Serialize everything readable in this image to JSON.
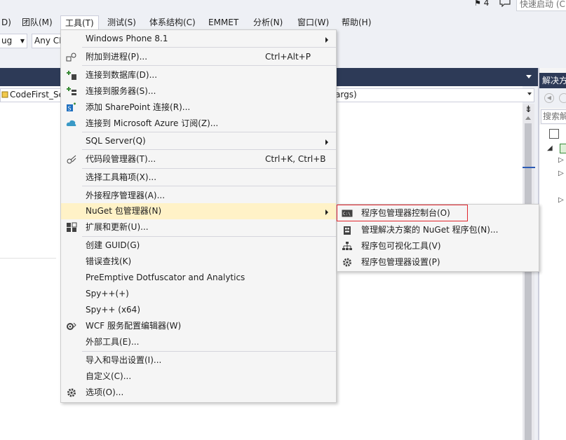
{
  "top": {
    "notif_count": "4",
    "quick_launch_placeholder": "快速启动 (C"
  },
  "menubar": {
    "items": [
      "D)",
      "团队(M)",
      "工具(T)",
      "测试(S)",
      "体系结构(C)",
      "EMMET",
      "分析(N)",
      "窗口(W)",
      "帮助(H)"
    ]
  },
  "toolbar": {
    "config_value": "ug",
    "platform_value": "Any CF"
  },
  "editor": {
    "nav_left": "CodeFirst_Se",
    "nav_right": "args)"
  },
  "solution_explorer": {
    "title": "解决方",
    "search_placeholder": "搜索解"
  },
  "tools_menu": {
    "items": [
      {
        "label": "Windows Phone 8.1",
        "shortcut": "",
        "submenu": true,
        "icon": ""
      },
      {
        "label": "附加到进程(P)...",
        "shortcut": "Ctrl+Alt+P",
        "submenu": false,
        "icon": "attach-process-icon"
      },
      {
        "label": "连接到数据库(D)...",
        "shortcut": "",
        "submenu": false,
        "icon": "connect-database-icon"
      },
      {
        "label": "连接到服务器(S)...",
        "shortcut": "",
        "submenu": false,
        "icon": "connect-server-icon"
      },
      {
        "label": "添加 SharePoint 连接(R)...",
        "shortcut": "",
        "submenu": false,
        "icon": "sharepoint-icon"
      },
      {
        "label": "连接到 Microsoft Azure 订阅(Z)...",
        "shortcut": "",
        "submenu": false,
        "icon": "azure-cloud-icon"
      },
      {
        "label": "SQL Server(Q)",
        "shortcut": "",
        "submenu": true,
        "icon": ""
      },
      {
        "label": "代码段管理器(T)...",
        "shortcut": "Ctrl+K, Ctrl+B",
        "submenu": false,
        "icon": "snippet-manager-icon"
      },
      {
        "label": "选择工具箱项(X)...",
        "shortcut": "",
        "submenu": false,
        "icon": ""
      },
      {
        "label": "外接程序管理器(A)...",
        "shortcut": "",
        "submenu": false,
        "icon": ""
      },
      {
        "label": "NuGet 包管理器(N)",
        "shortcut": "",
        "submenu": true,
        "icon": ""
      },
      {
        "label": "扩展和更新(U)...",
        "shortcut": "",
        "submenu": false,
        "icon": "extensions-icon"
      },
      {
        "label": "创建 GUID(G)",
        "shortcut": "",
        "submenu": false,
        "icon": ""
      },
      {
        "label": "错误查找(K)",
        "shortcut": "",
        "submenu": false,
        "icon": ""
      },
      {
        "label": "PreEmptive Dotfuscator and Analytics",
        "shortcut": "",
        "submenu": false,
        "icon": ""
      },
      {
        "label": "Spy++(+)",
        "shortcut": "",
        "submenu": false,
        "icon": ""
      },
      {
        "label": "Spy++ (x64)",
        "shortcut": "",
        "submenu": false,
        "icon": ""
      },
      {
        "label": "WCF 服务配置编辑器(W)",
        "shortcut": "",
        "submenu": false,
        "icon": "wcf-config-icon"
      },
      {
        "label": "外部工具(E)...",
        "shortcut": "",
        "submenu": false,
        "icon": ""
      },
      {
        "label": "导入和导出设置(I)...",
        "shortcut": "",
        "submenu": false,
        "icon": ""
      },
      {
        "label": "自定义(C)...",
        "shortcut": "",
        "submenu": false,
        "icon": ""
      },
      {
        "label": "选项(O)...",
        "shortcut": "",
        "submenu": false,
        "icon": "gear-icon"
      }
    ]
  },
  "nuget_submenu": {
    "items": [
      {
        "label": "程序包管理器控制台(O)",
        "icon": "console-icon"
      },
      {
        "label": "管理解决方案的 NuGet 程序包(N)...",
        "icon": "package-icon"
      },
      {
        "label": "程序包可视化工具(V)",
        "icon": "hierarchy-icon"
      },
      {
        "label": "程序包管理器设置(P)",
        "icon": "gear-icon"
      }
    ]
  },
  "colors": {
    "menu_highlight": "#fff2c7",
    "dark_band": "#2d3a57",
    "red_box": "#e0262d"
  }
}
